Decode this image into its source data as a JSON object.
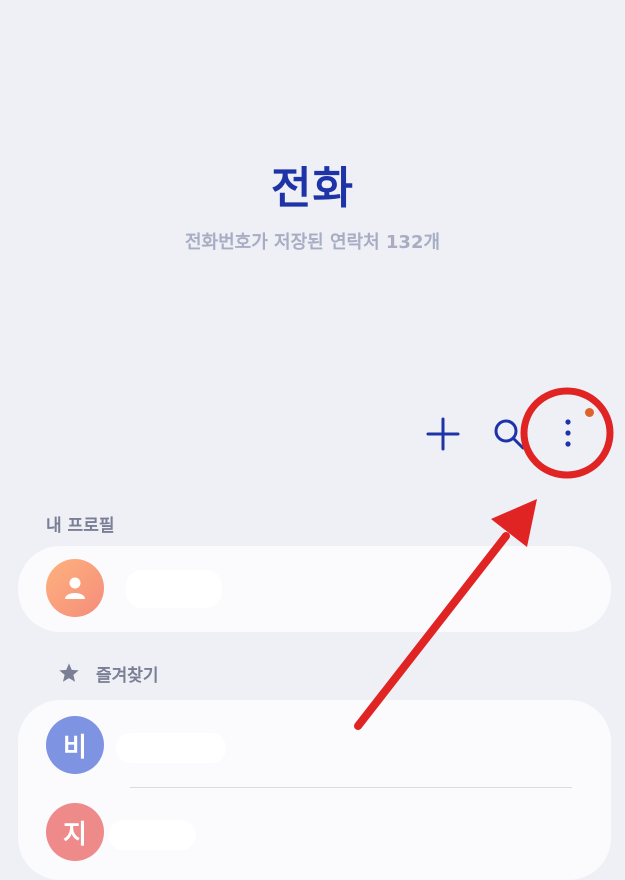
{
  "header": {
    "title": "전화",
    "subtitle": "전화번호가 저장된 연락처 132개"
  },
  "toolbar": {
    "add_icon": "plus-icon",
    "search_icon": "search-icon",
    "more_icon": "more-vertical-icon",
    "notification_dot_color": "#e0622b",
    "icon_color": "#1f33a8"
  },
  "profile_section": {
    "label": "내 프로필",
    "avatar_icon": "person-icon"
  },
  "favorites_section": {
    "label": "즐겨찾기",
    "star_icon": "star-icon",
    "contacts": [
      {
        "initial": "비",
        "color": "#7f93e3"
      },
      {
        "initial": "지",
        "color": "#ef8a8a"
      }
    ]
  },
  "annotation": {
    "highlight_color": "#e02424"
  }
}
